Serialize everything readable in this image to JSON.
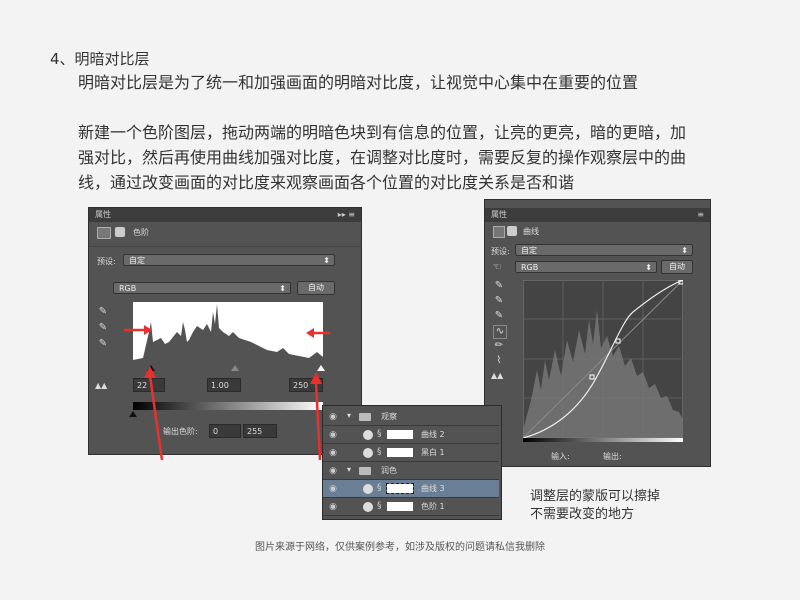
{
  "heading": "4、明暗对比层",
  "para1": "明暗对比层是为了统一和加强画面的明暗对比度，让视觉中心集中在重要的位置",
  "para2_lines": [
    "新建一个色阶图层，拖动两端的明暗色块到有信息的位置，让亮的更亮，暗的更暗，加",
    "强对比，然后再使用曲线加强对比度，在调整对比度时，需要反复的操作观察层中的曲",
    "线，通过改变画面的对比度来观察画面各个位置的对比度关系是否和谐"
  ],
  "levels_panel": {
    "tab_title": "属性",
    "panel_title": "色阶",
    "preset_label": "预设:",
    "preset_value": "自定",
    "channel_value": "RGB",
    "auto_label": "自动",
    "input_black": "22",
    "input_mid": "1.00",
    "input_white": "250",
    "output_label": "输出色阶:",
    "output_black": "0",
    "output_white": "255"
  },
  "curves_panel": {
    "tab_title": "属性",
    "panel_title": "曲线",
    "preset_label": "预设:",
    "preset_value": "自定",
    "channel_value": "RGB",
    "auto_label": "自动",
    "input_label": "输入:",
    "output_label": "输出:"
  },
  "layers": [
    {
      "name": "观察",
      "type": "group",
      "selected": false
    },
    {
      "name": "曲线 2",
      "type": "adjustment",
      "selected": false
    },
    {
      "name": "黑白 1",
      "type": "adjustment",
      "selected": false
    },
    {
      "name": "润色",
      "type": "group",
      "selected": false
    },
    {
      "name": "曲线 3",
      "type": "adjustment",
      "selected": true
    },
    {
      "name": "色阶 1",
      "type": "adjustment",
      "selected": false
    }
  ],
  "note_lines": [
    "调整层的蒙版可以擦掉",
    "不需要改变的地方"
  ],
  "credit": "图片来源于网络，仅供案例参考，如涉及版权的问题请私信我删除",
  "colors": {
    "arrow": "#e8312f",
    "panel_bg": "#535353",
    "selected_row": "#6a7f95"
  }
}
